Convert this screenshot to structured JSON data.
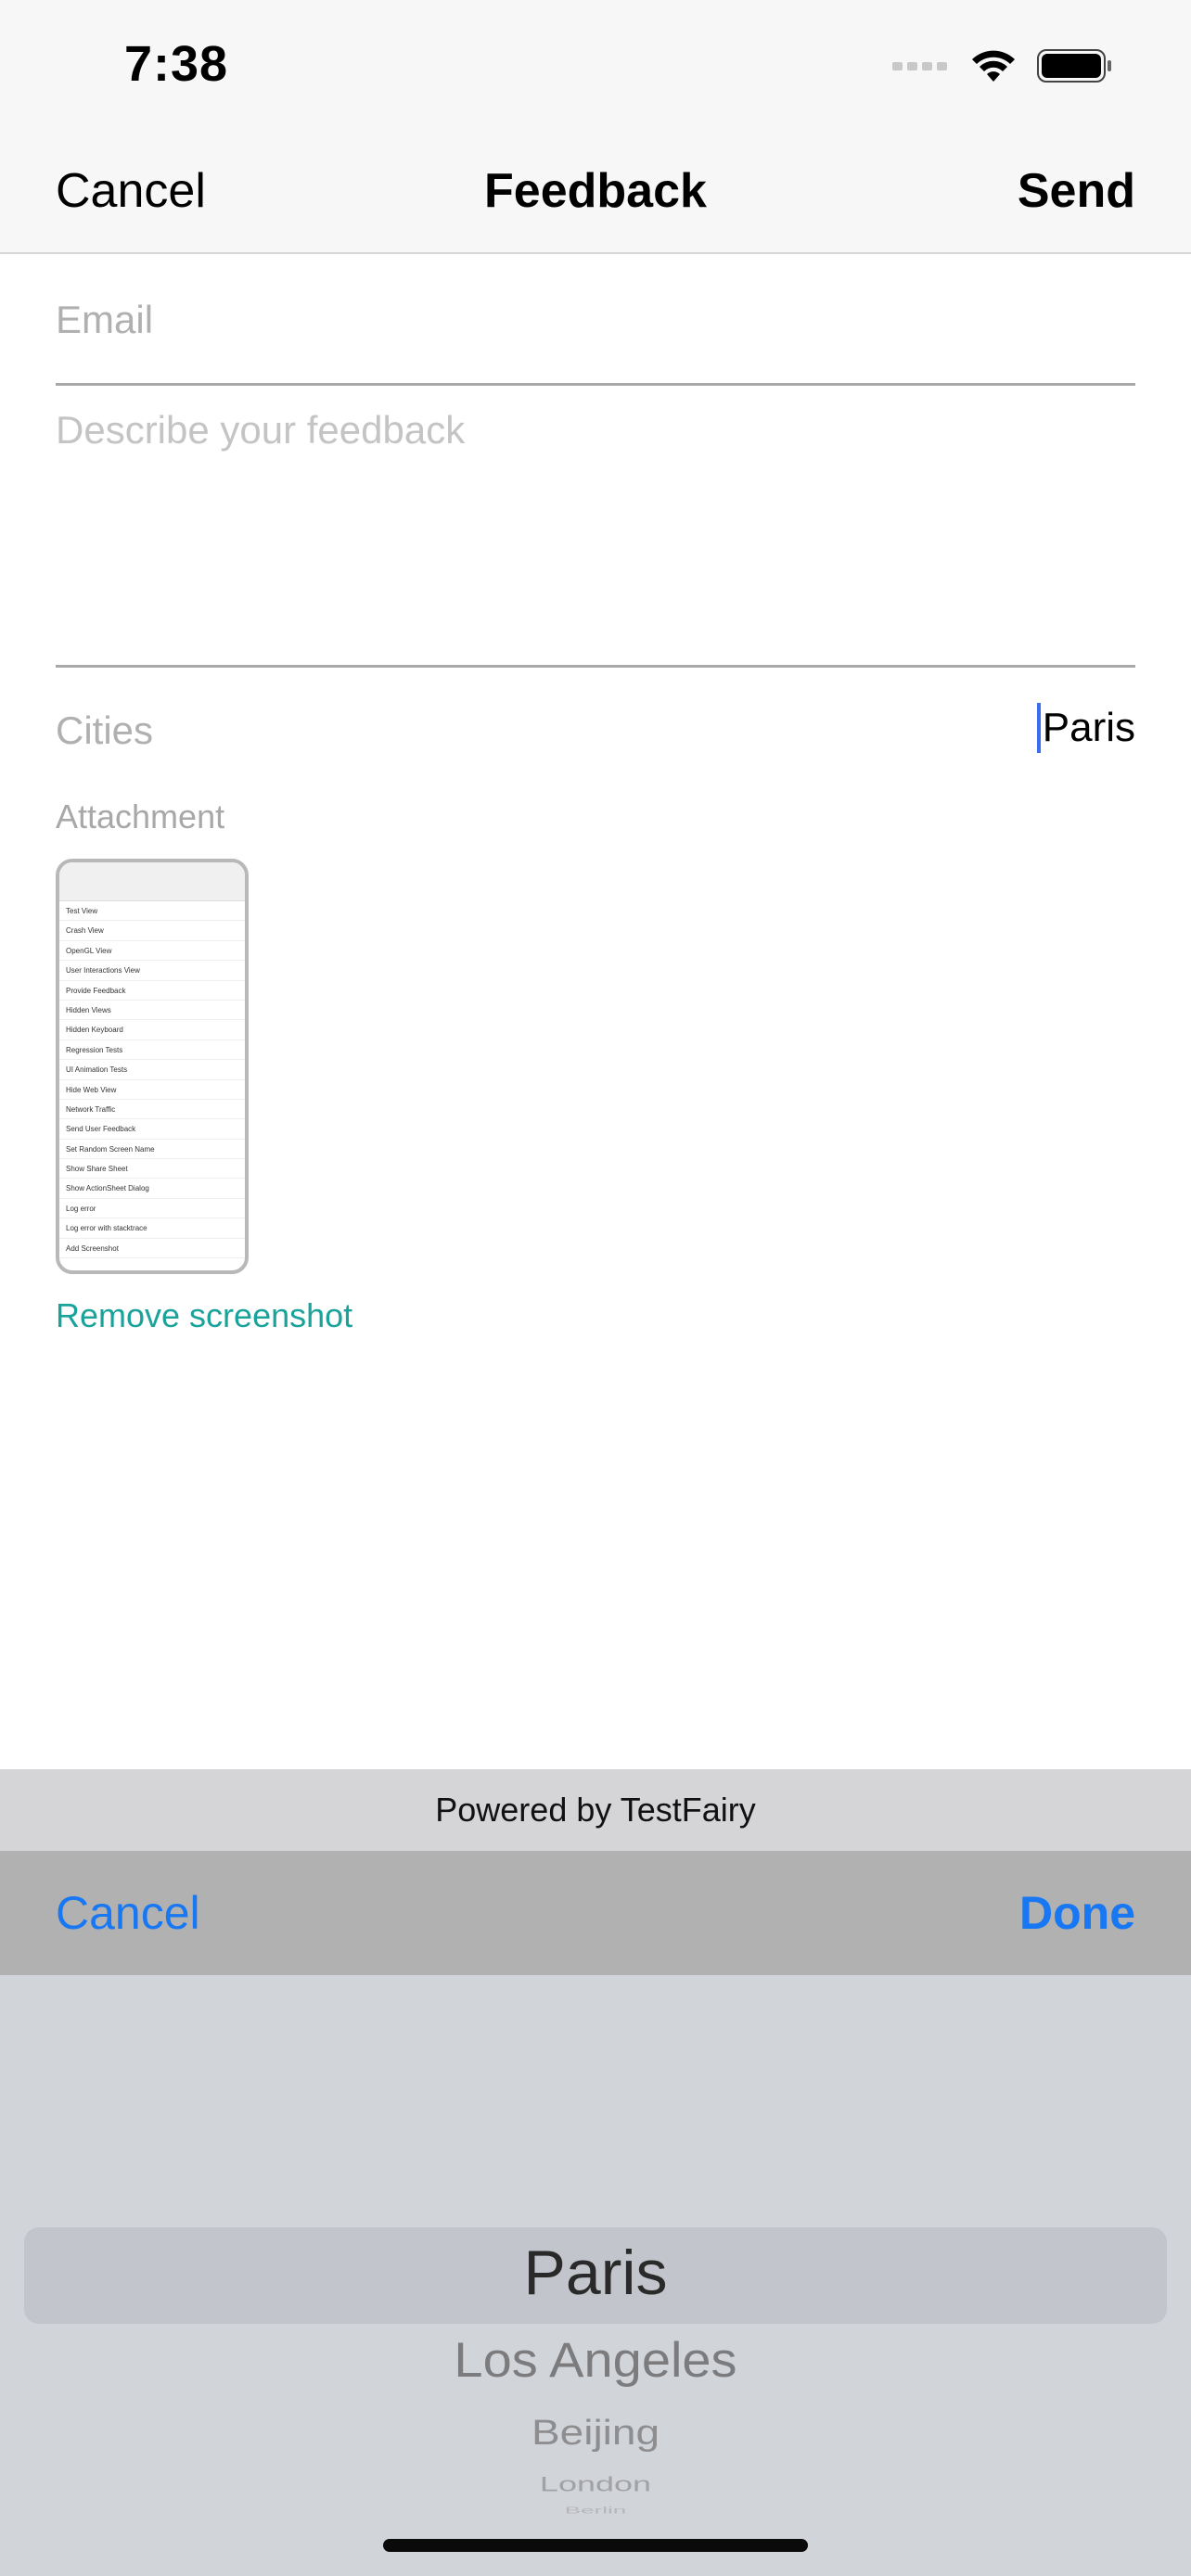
{
  "status_bar": {
    "time": "7:38"
  },
  "nav": {
    "cancel_label": "Cancel",
    "title": "Feedback",
    "send_label": "Send"
  },
  "form": {
    "email_placeholder": "Email",
    "feedback_placeholder": "Describe your feedback",
    "cities_label": "Cities",
    "cities_value": "Paris",
    "attachment_label": "Attachment",
    "remove_screenshot_label": "Remove screenshot"
  },
  "thumbnail": {
    "items": [
      "Test View",
      "Crash View",
      "OpenGL View",
      "User Interactions View",
      "Provide Feedback",
      "Hidden Views",
      "Hidden Keyboard",
      "Regression Tests",
      "UI Animation Tests",
      "Hide Web View",
      "Network Traffic",
      "Send User Feedback",
      "Set Random Screen Name",
      "Show Share Sheet",
      "Show ActionSheet Dialog",
      "Log error",
      "Log error with stacktrace",
      "Add Screenshot"
    ]
  },
  "footer": {
    "powered_by": "Powered by TestFairy"
  },
  "picker_toolbar": {
    "cancel_label": "Cancel",
    "done_label": "Done"
  },
  "picker": {
    "selected": "Paris",
    "items": [
      "Paris",
      "Los Angeles",
      "Beijing",
      "London",
      "Berlin"
    ]
  },
  "colors": {
    "accent_blue": "#1877f2",
    "link_teal": "#1aa39a",
    "caret_blue": "#3a6df0"
  }
}
